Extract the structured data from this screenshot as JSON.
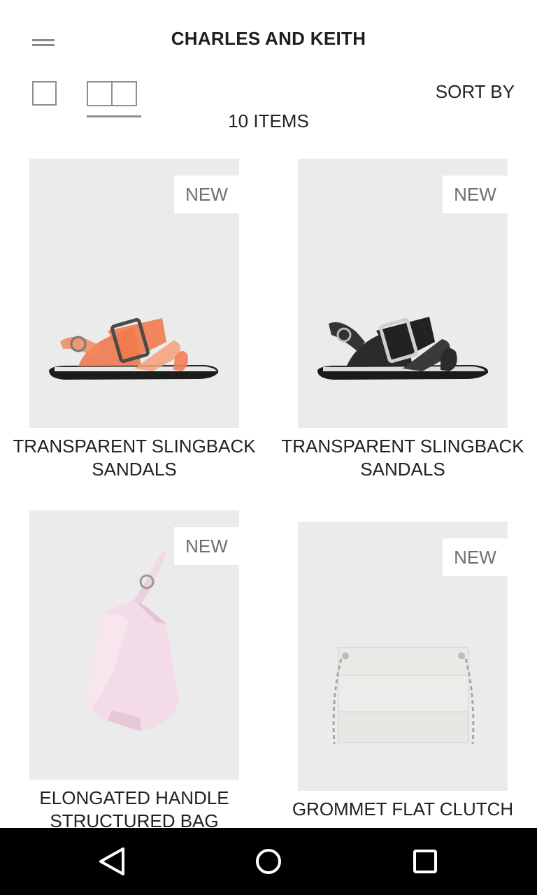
{
  "app": {
    "title": "CHARLES AND KEITH"
  },
  "toolbar": {
    "menu_icon": "hamburger-menu-icon",
    "view_single_icon": "single-column-view-icon",
    "view_grid_icon": "two-column-grid-view-icon",
    "sort_label": "SORT BY"
  },
  "listing": {
    "count_label": "10 ITEMS"
  },
  "products": [
    {
      "badge": "NEW",
      "name_line1": "TRANSPARENT SLINGBACK",
      "name_line2": "SANDALS",
      "image": "orange-transparent-sandal"
    },
    {
      "badge": "NEW",
      "name_line1": "TRANSPARENT SLINGBACK",
      "name_line2": "SANDALS",
      "image": "black-transparent-sandal"
    },
    {
      "badge": "NEW",
      "name_line1": "ELONGATED HANDLE",
      "name_line2": "STRUCTURED BAG",
      "image": "pink-structured-bag"
    },
    {
      "badge": "NEW",
      "name_line1": "GROMMET FLAT CLUTCH",
      "name_line2": "",
      "image": "white-chain-clutch"
    }
  ],
  "system_nav": {
    "back_icon": "back-triangle-icon",
    "home_icon": "home-circle-icon",
    "recents_icon": "recents-square-icon"
  },
  "colors": {
    "image_background": "#ebebeb",
    "badge_text": "#6f6f6f",
    "icon_gray": "#8e8e8e",
    "nav_background": "#000000"
  }
}
